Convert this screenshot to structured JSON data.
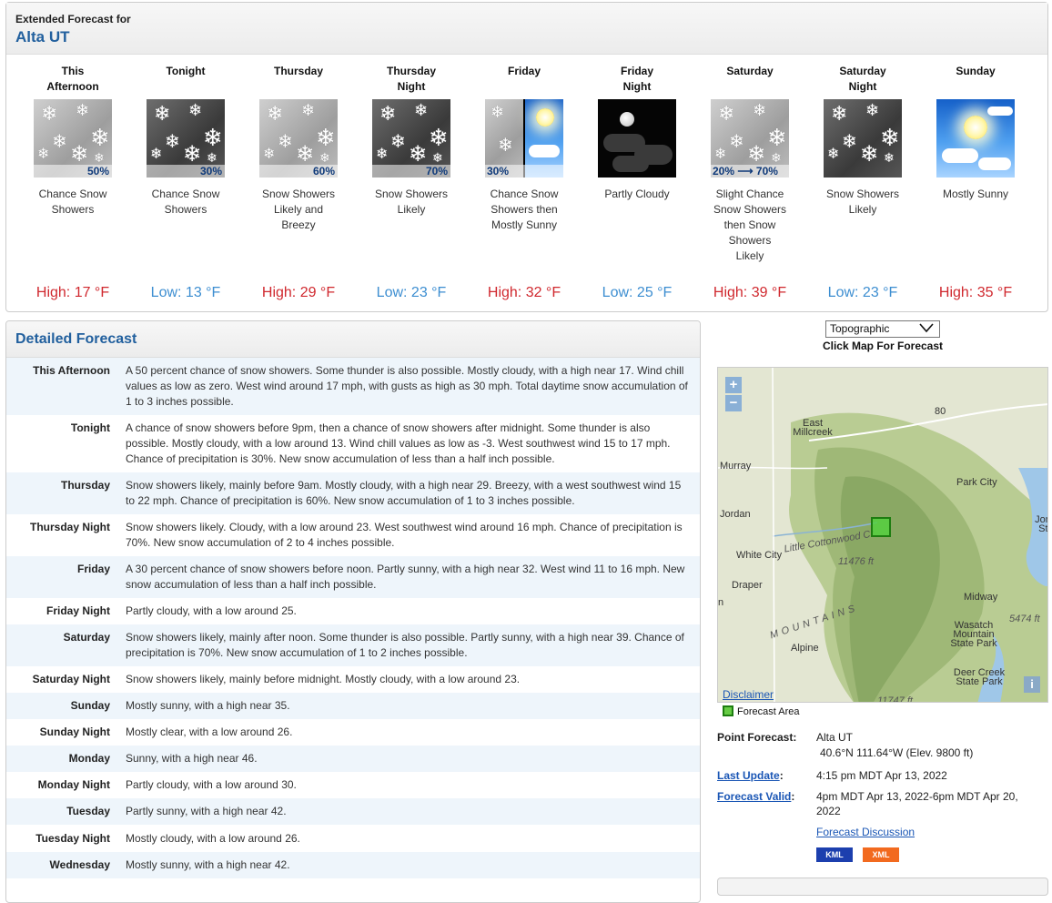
{
  "extended": {
    "header_small": "Extended Forecast for",
    "location": "Alta UT",
    "periods": [
      {
        "name_l1": "This",
        "name_l2": "Afternoon",
        "icon": "snow-showers-day",
        "pct": "50%",
        "short": [
          "Chance Snow",
          "Showers"
        ],
        "temp": "High: 17 °F",
        "kind": "high"
      },
      {
        "name_l1": "Tonight",
        "name_l2": "",
        "icon": "snow-showers-night",
        "pct": "30%",
        "short": [
          "Chance Snow",
          "Showers"
        ],
        "temp": "Low: 13 °F",
        "kind": "low"
      },
      {
        "name_l1": "Thursday",
        "name_l2": "",
        "icon": "snow-showers-day",
        "pct": "60%",
        "short": [
          "Snow Showers",
          "Likely and",
          "Breezy"
        ],
        "temp": "High: 29 °F",
        "kind": "high"
      },
      {
        "name_l1": "Thursday",
        "name_l2": "Night",
        "icon": "snow-showers-night",
        "pct": "70%",
        "short": [
          "Snow Showers",
          "Likely"
        ],
        "temp": "Low: 23 °F",
        "kind": "low"
      },
      {
        "name_l1": "Friday",
        "name_l2": "",
        "icon": "snow-then-sunny",
        "pct": "30%",
        "short": [
          "Chance Snow",
          "Showers then",
          "Mostly Sunny"
        ],
        "temp": "High: 32 °F",
        "kind": "high"
      },
      {
        "name_l1": "Friday",
        "name_l2": "Night",
        "icon": "partly-cloudy-night",
        "pct": "",
        "short": [
          "Partly Cloudy"
        ],
        "temp": "Low: 25 °F",
        "kind": "low"
      },
      {
        "name_l1": "Saturday",
        "name_l2": "",
        "icon": "snow-showers-day",
        "pct": "20% ⟶ 70%",
        "short": [
          "Slight Chance",
          "Snow Showers",
          "then Snow",
          "Showers",
          "Likely"
        ],
        "temp": "High: 39 °F",
        "kind": "high"
      },
      {
        "name_l1": "Saturday",
        "name_l2": "Night",
        "icon": "snow-showers-night",
        "pct": "",
        "short": [
          "Snow Showers",
          "Likely"
        ],
        "temp": "Low: 23 °F",
        "kind": "low"
      },
      {
        "name_l1": "Sunday",
        "name_l2": "",
        "icon": "mostly-sunny",
        "pct": "",
        "short": [
          "Mostly Sunny"
        ],
        "temp": "High: 35 °F",
        "kind": "high"
      }
    ]
  },
  "detailed": {
    "title": "Detailed Forecast",
    "rows": [
      {
        "label": "This Afternoon",
        "text": "A 50 percent chance of snow showers. Some thunder is also possible. Mostly cloudy, with a high near 17. Wind chill values as low as zero. West wind around 17 mph, with gusts as high as 30 mph. Total daytime snow accumulation of 1 to 3 inches possible."
      },
      {
        "label": "Tonight",
        "text": "A chance of snow showers before 9pm, then a chance of snow showers after midnight. Some thunder is also possible. Mostly cloudy, with a low around 13. Wind chill values as low as -3. West southwest wind 15 to 17 mph. Chance of precipitation is 30%. New snow accumulation of less than a half inch possible."
      },
      {
        "label": "Thursday",
        "text": "Snow showers likely, mainly before 9am. Mostly cloudy, with a high near 29. Breezy, with a west southwest wind 15 to 22 mph. Chance of precipitation is 60%. New snow accumulation of 1 to 3 inches possible."
      },
      {
        "label": "Thursday Night",
        "text": "Snow showers likely. Cloudy, with a low around 23. West southwest wind around 16 mph. Chance of precipitation is 70%. New snow accumulation of 2 to 4 inches possible."
      },
      {
        "label": "Friday",
        "text": "A 30 percent chance of snow showers before noon. Partly sunny, with a high near 32. West wind 11 to 16 mph. New snow accumulation of less than a half inch possible."
      },
      {
        "label": "Friday Night",
        "text": "Partly cloudy, with a low around 25."
      },
      {
        "label": "Saturday",
        "text": "Snow showers likely, mainly after noon. Some thunder is also possible. Partly sunny, with a high near 39. Chance of precipitation is 70%. New snow accumulation of 1 to 2 inches possible."
      },
      {
        "label": "Saturday Night",
        "text": "Snow showers likely, mainly before midnight. Mostly cloudy, with a low around 23."
      },
      {
        "label": "Sunday",
        "text": "Mostly sunny, with a high near 35."
      },
      {
        "label": "Sunday Night",
        "text": "Mostly clear, with a low around 26."
      },
      {
        "label": "Monday",
        "text": "Sunny, with a high near 46."
      },
      {
        "label": "Monday Night",
        "text": "Partly cloudy, with a low around 30."
      },
      {
        "label": "Tuesday",
        "text": "Partly sunny, with a high near 42."
      },
      {
        "label": "Tuesday Night",
        "text": "Mostly cloudy, with a low around 26."
      },
      {
        "label": "Wednesday",
        "text": "Mostly sunny, with a high near 42."
      }
    ]
  },
  "map": {
    "select_value": "Topographic",
    "hint": "Click Map For Forecast",
    "zoom_in": "+",
    "zoom_out": "−",
    "labels": [
      "East Millcreek",
      "Murray",
      "Park City",
      "Jordan",
      "Jordan State",
      "White City",
      "Little Cottonwood Cr",
      "11476 ft",
      "Draper",
      "Midway",
      "5474 ft",
      "MOUNTAINS",
      "Wasatch Mountain State Park",
      "Alpine",
      "Deer Creek State Park",
      "11747 ft",
      "80",
      "n"
    ],
    "disclaimer": "Disclaimer",
    "legend": "Forecast Area",
    "info": "i"
  },
  "point": {
    "point_label": "Point Forecast:",
    "point_name": "Alta UT",
    "coords": "40.6°N 111.64°W (Elev. 9800 ft)",
    "update_label": "Last Update",
    "update_colon": ":",
    "update_value": "4:15 pm MDT Apr 13, 2022",
    "valid_label": "Forecast Valid",
    "valid_colon": ":",
    "valid_value_1": "4pm MDT Apr 13, 2022-6pm MDT Apr 20,",
    "valid_value_2": "2022",
    "discussion": "Forecast Discussion",
    "kml": "KML",
    "xml": "XML"
  },
  "colors": {
    "link": "#1a56b5",
    "high": "#d0282e",
    "low": "#3d8ed1",
    "kml": "#1c3fae",
    "xml": "#f26a1f"
  }
}
